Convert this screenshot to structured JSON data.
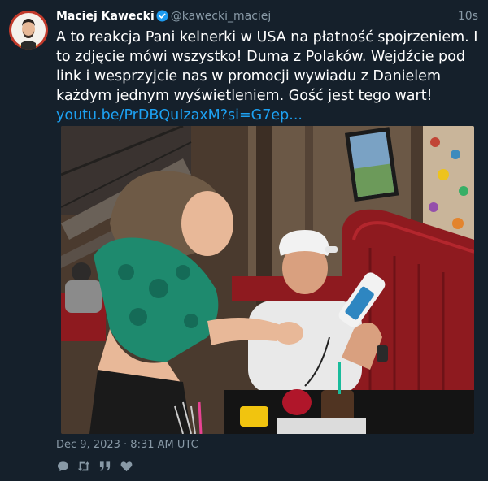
{
  "tweet": {
    "author_name": "Maciej Kawecki",
    "handle": "@kawecki_maciej",
    "time_ago": "10s",
    "text": "A to reakcja Pani kelnerki w USA na płatność spojrzeniem. I to zdjęcie mówi wszystko! Duma z Polaków. Wejdźcie pod link i wesprzyjcie nas w promocji wywiadu z Danielem każdym jednym wyświetleniem. Gość jest tego wart!",
    "link_text": "youtu.be/PrDBQuIzaxM?si=G7ep...",
    "timestamp": "Dec 9, 2023 · 8:31 AM UTC"
  },
  "icons": {
    "verified": "verified-badge-icon",
    "reply": "reply-icon",
    "retweet": "retweet-icon",
    "quote": "quote-icon",
    "like": "heart-icon"
  },
  "colors": {
    "background": "#15202b",
    "link": "#1da1f2",
    "muted": "#8899a6",
    "verified": "#1d9bf0"
  }
}
